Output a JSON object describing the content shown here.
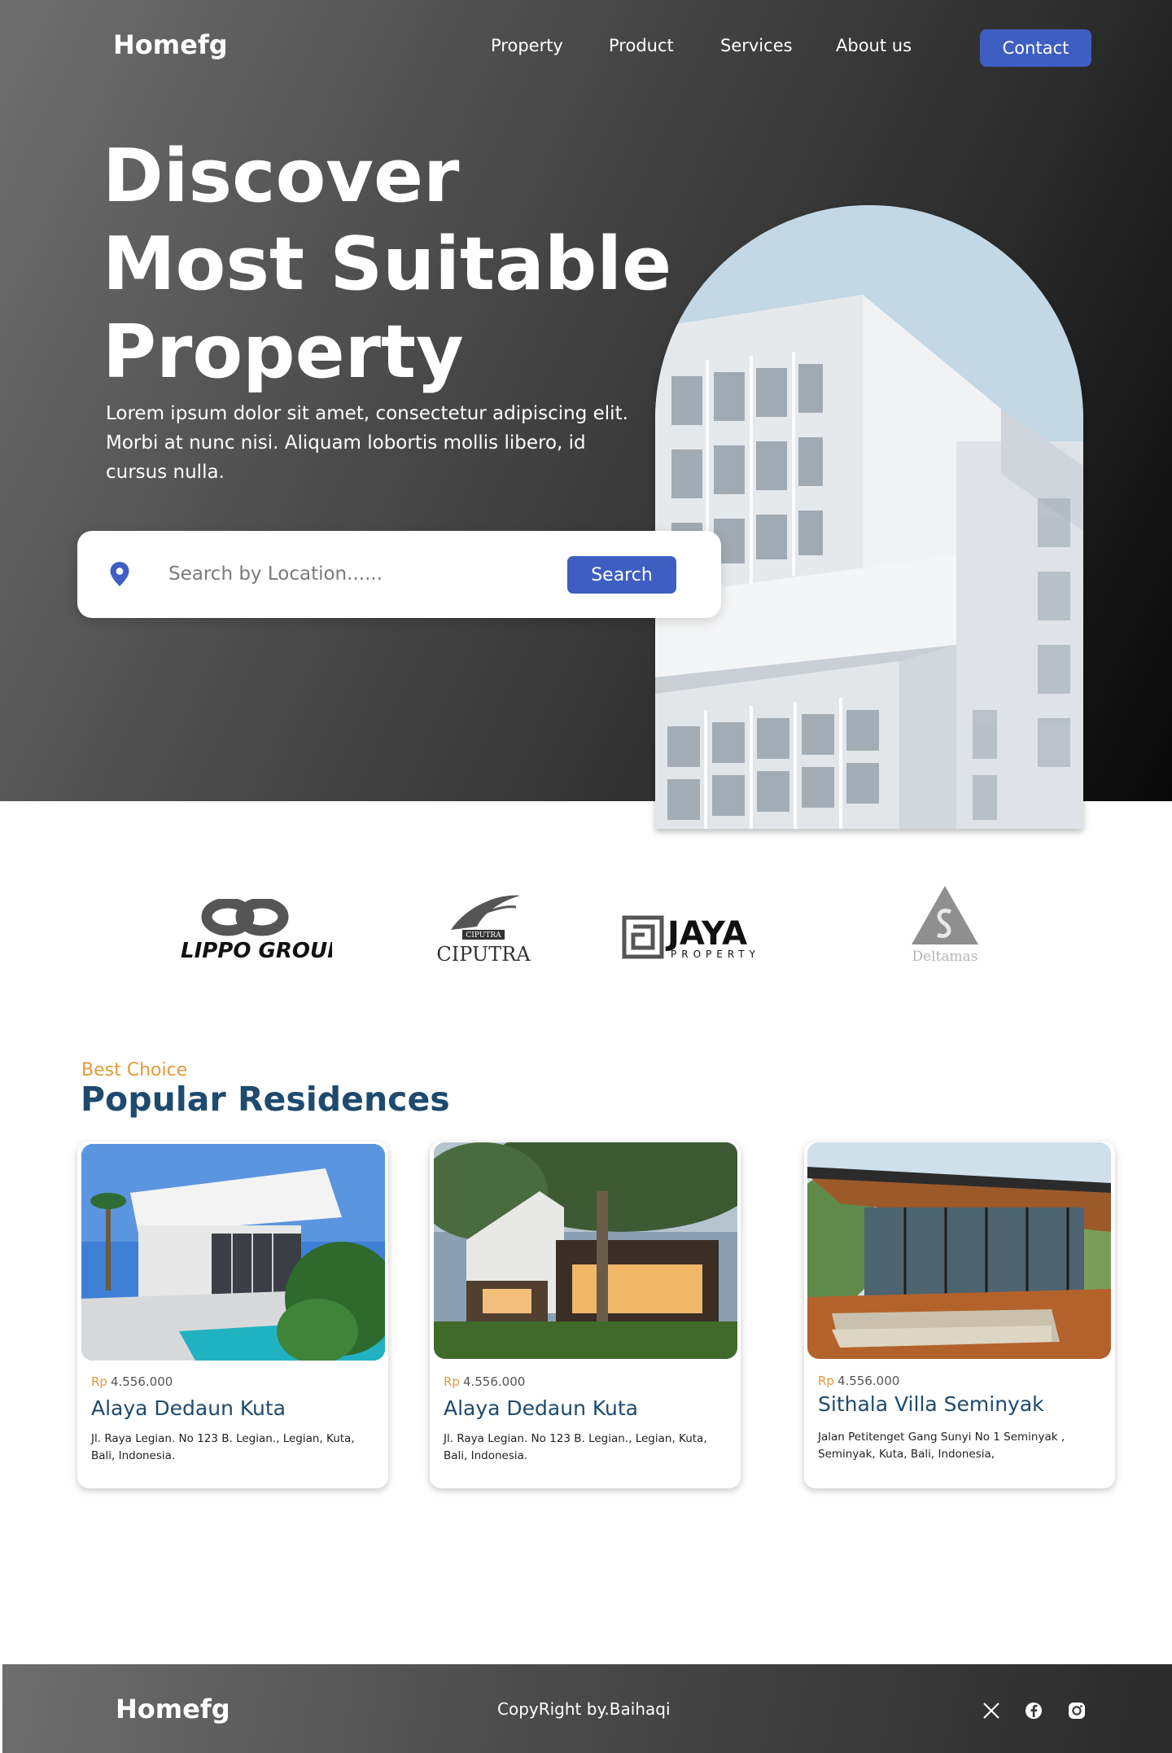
{
  "brand": "Homefg",
  "nav": {
    "links": [
      "Property",
      "Product",
      "Services",
      "About us"
    ],
    "contact_label": "Contact"
  },
  "hero": {
    "headline": [
      "Discover",
      "Most Suitable",
      "Property"
    ],
    "description": "Lorem ipsum dolor sit amet, consectetur adipiscing elit. Morbi at nunc nisi. Aliquam lobortis mollis libero, id cursus nulla.",
    "search": {
      "placeholder": "Search by Location......",
      "value": "",
      "button_label": "Search",
      "icon": "location-pin-icon"
    },
    "image": "modern-white-building-arch"
  },
  "partners": [
    {
      "name": "LIPPO GROUP"
    },
    {
      "name": "CIPUTRA",
      "badge": "CIPUTRA"
    },
    {
      "name": "JAYA",
      "sub": "PROPERTY"
    },
    {
      "name": "Deltamas"
    }
  ],
  "section": {
    "eyebrow": "Best Choice",
    "title": "Popular Residences"
  },
  "residences": [
    {
      "currency": "Rp",
      "price": "4.556.000",
      "name": "Alaya Dedaun Kuta",
      "address": "Jl. Raya Legian. No 123 B. Legian., Legian, Kuta, Bali, Indonesia."
    },
    {
      "currency": "Rp",
      "price": "4.556.000",
      "name": "Alaya Dedaun Kuta",
      "address": "Jl. Raya Legian. No 123 B. Legian., Legian, Kuta, Bali, Indonesia."
    },
    {
      "currency": "Rp",
      "price": "4.556.000",
      "name": "Sithala Villa Seminyak",
      "address": "Jalan Petitenget Gang Sunyi No 1 Seminyak , Seminyak, Kuta, Bali, Indonesia,"
    }
  ],
  "footer": {
    "brand": "Homefg",
    "copyright": "CopyRight by.Baihaqi",
    "social": [
      "x-icon",
      "facebook-icon",
      "instagram-icon"
    ]
  },
  "colors": {
    "accent": "#3e5fc1",
    "eyebrow": "#e39a3a",
    "title": "#1e4a6e"
  }
}
